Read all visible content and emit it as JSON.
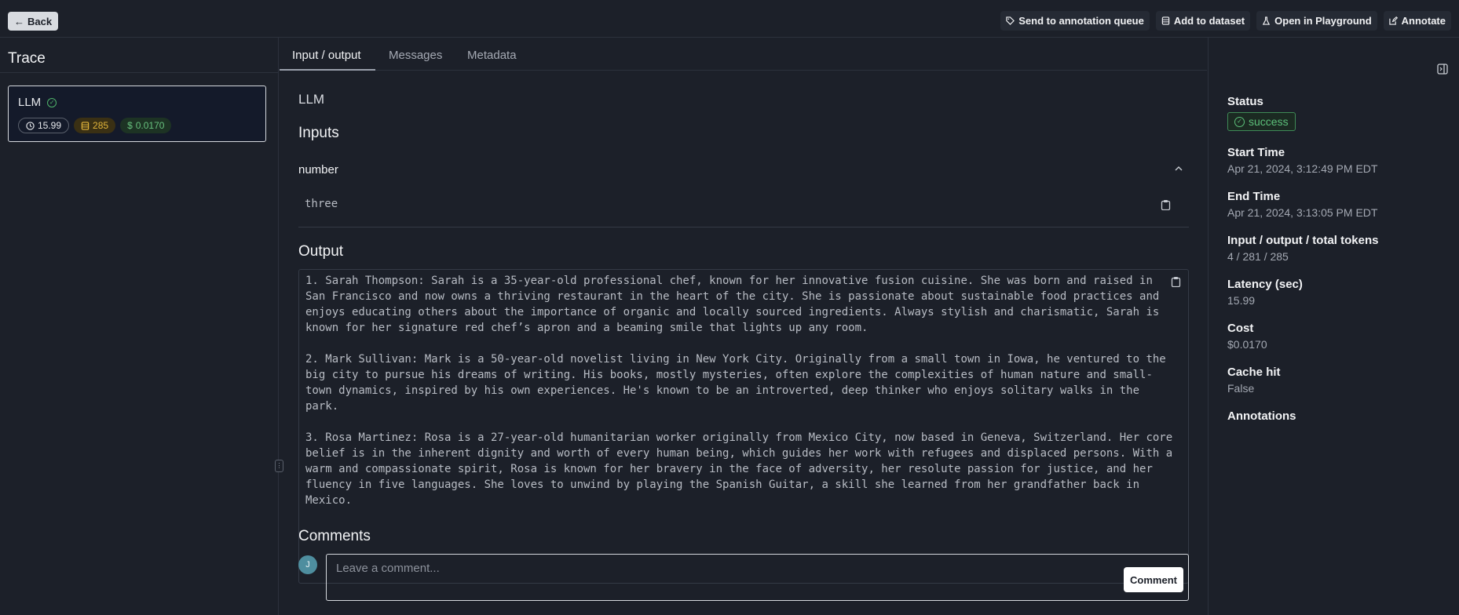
{
  "topbar": {
    "back_label": "Back",
    "actions": [
      {
        "label": "Send to annotation queue",
        "icon": "tag-icon"
      },
      {
        "label": "Add to dataset",
        "icon": "database-icon"
      },
      {
        "label": "Open in Playground",
        "icon": "flask-icon"
      },
      {
        "label": "Annotate",
        "icon": "edit-icon"
      }
    ]
  },
  "sidebar": {
    "title": "Trace",
    "run": {
      "name": "LLM",
      "latency": "15.99",
      "tokens": "285",
      "cost": "0.0170"
    }
  },
  "tabs": [
    {
      "label": "Input / output",
      "active": true
    },
    {
      "label": "Messages",
      "active": false
    },
    {
      "label": "Metadata",
      "active": false
    }
  ],
  "main": {
    "run_name": "LLM",
    "inputs_heading": "Inputs",
    "input_field": {
      "label": "number",
      "value": "three"
    },
    "output_heading": "Output",
    "output_text": "1. Sarah Thompson: Sarah is a 35-year-old professional chef, known for her innovative fusion cuisine. She was born and raised in San Francisco and now owns a thriving restaurant in the heart of the city. She is passionate about sustainable food practices and enjoys educating others about the importance of organic and locally sourced ingredients. Always stylish and charismatic, Sarah is known for her signature red chef’s apron and a beaming smile that lights up any room.\n\n2. Mark Sullivan: Mark is a 50-year-old novelist living in New York City. Originally from a small town in Iowa, he ventured to the big city to pursue his dreams of writing. His books, mostly mysteries, often explore the complexities of human nature and small-town dynamics, inspired by his own experiences. He's known to be an introverted, deep thinker who enjoys solitary walks in the park.\n\n3. Rosa Martinez: Rosa is a 27-year-old humanitarian worker originally from Mexico City, now based in Geneva, Switzerland. Her core belief is in the inherent dignity and worth of every human being, which guides her work with refugees and displaced persons. With a warm and compassionate spirit, Rosa is known for her bravery in the face of adversity, her resolute passion for justice, and her fluency in five languages. She loves to unwind by playing the Spanish Guitar, a skill she learned from her grandfather back in Mexico.",
    "comments_heading": "Comments",
    "avatar_initial": "J",
    "comment_placeholder": "Leave a comment...",
    "comment_button": "Comment"
  },
  "details": {
    "status_label": "Status",
    "status_value": "success",
    "start_label": "Start Time",
    "start_value": "Apr 21, 2024, 3:12:49 PM EDT",
    "end_label": "End Time",
    "end_value": "Apr 21, 2024, 3:13:05 PM EDT",
    "tokens_label": "Input / output / total tokens",
    "tokens_value": "4 / 281 / 285",
    "latency_label": "Latency (sec)",
    "latency_value": "15.99",
    "cost_label": "Cost",
    "cost_value": "$0.0170",
    "cache_label": "Cache hit",
    "cache_value": "False",
    "annotations_label": "Annotations"
  },
  "colors": {
    "background": "#1c2029",
    "success": "#5cc07a",
    "tokens_chip": "#e2b53a",
    "card_bg": "#141a2a"
  }
}
